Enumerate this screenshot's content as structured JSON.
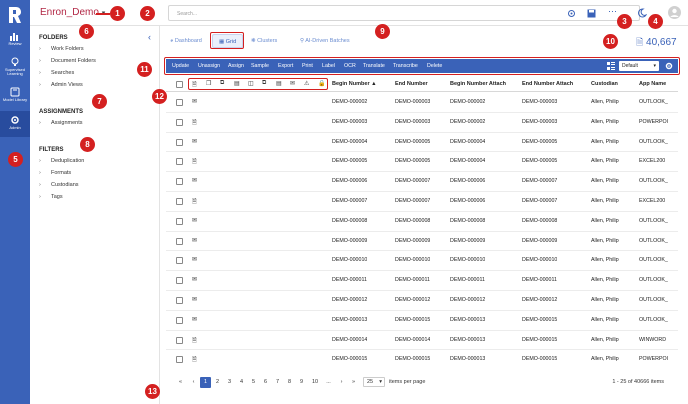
{
  "app": {
    "name": "Enron_Demo",
    "brand_color": "#b22745",
    "accent": "#3a62b8"
  },
  "search": {
    "placeholder": "Search..."
  },
  "rail": [
    {
      "label": "Review"
    },
    {
      "label": "Supervised Learning"
    },
    {
      "label": "Model Library"
    },
    {
      "label": "Admin"
    }
  ],
  "sidebar": {
    "folders_title": "FOLDERS",
    "folders": [
      "Work Folders",
      "Document Folders",
      "Searches",
      "Admin Views"
    ],
    "assignments_title": "ASSIGNMENTS",
    "assignments": [
      "Assignments"
    ],
    "filters_title": "FILTERS",
    "filters": [
      "Deduplication",
      "Formats",
      "Custodians",
      "Tags"
    ]
  },
  "tabs": [
    {
      "label": "Dashboard",
      "icon": "dashboard-icon"
    },
    {
      "label": "Grid",
      "icon": "grid-icon",
      "selected": true
    },
    {
      "label": "Clusters",
      "icon": "clusters-icon"
    },
    {
      "label": "AI-Driven Batches",
      "icon": "location-icon"
    }
  ],
  "doc_count": "40,667",
  "toolbar": {
    "actions": [
      "Update",
      "Unassign",
      "Assign",
      "Sample",
      "Export",
      "Print",
      "Label",
      "OCR",
      "Translate",
      "Transcribe",
      "Delete"
    ],
    "view_name": "Default"
  },
  "grid": {
    "columns": [
      "Begin Number",
      "End Number",
      "Begin Number Attach",
      "End Number Attach",
      "Custodian",
      "App Name"
    ],
    "sort_indicator": "▲",
    "rows": [
      {
        "begin": "DEMO-000002",
        "end": "DEMO-000003",
        "battach": "DEMO-000002",
        "eattach": "DEMO-000003",
        "custodian": "Allen, Philip",
        "app": "OUTLOOK_",
        "type": "mail"
      },
      {
        "begin": "DEMO-000003",
        "end": "DEMO-000003",
        "battach": "DEMO-000002",
        "eattach": "DEMO-000003",
        "custodian": "Allen, Philip",
        "app": "POWERPOI",
        "type": "doc"
      },
      {
        "begin": "DEMO-000004",
        "end": "DEMO-000005",
        "battach": "DEMO-000004",
        "eattach": "DEMO-000005",
        "custodian": "Allen, Philip",
        "app": "OUTLOOK_",
        "type": "mail"
      },
      {
        "begin": "DEMO-000005",
        "end": "DEMO-000005",
        "battach": "DEMO-000004",
        "eattach": "DEMO-000005",
        "custodian": "Allen, Philip",
        "app": "EXCEL200",
        "type": "sheet"
      },
      {
        "begin": "DEMO-000006",
        "end": "DEMO-000007",
        "battach": "DEMO-000006",
        "eattach": "DEMO-000007",
        "custodian": "Allen, Philip",
        "app": "OUTLOOK_",
        "type": "mail"
      },
      {
        "begin": "DEMO-000007",
        "end": "DEMO-000007",
        "battach": "DEMO-000006",
        "eattach": "DEMO-000007",
        "custodian": "Allen, Philip",
        "app": "EXCEL200",
        "type": "sheet"
      },
      {
        "begin": "DEMO-000008",
        "end": "DEMO-000008",
        "battach": "DEMO-000008",
        "eattach": "DEMO-000008",
        "custodian": "Allen, Philip",
        "app": "OUTLOOK_",
        "type": "mail"
      },
      {
        "begin": "DEMO-000009",
        "end": "DEMO-000009",
        "battach": "DEMO-000009",
        "eattach": "DEMO-000009",
        "custodian": "Allen, Philip",
        "app": "OUTLOOK_",
        "type": "mail"
      },
      {
        "begin": "DEMO-000010",
        "end": "DEMO-000010",
        "battach": "DEMO-000010",
        "eattach": "DEMO-000010",
        "custodian": "Allen, Philip",
        "app": "OUTLOOK_",
        "type": "mail"
      },
      {
        "begin": "DEMO-000011",
        "end": "DEMO-000011",
        "battach": "DEMO-000011",
        "eattach": "DEMO-000011",
        "custodian": "Allen, Philip",
        "app": "OUTLOOK_",
        "type": "mail"
      },
      {
        "begin": "DEMO-000012",
        "end": "DEMO-000012",
        "battach": "DEMO-000012",
        "eattach": "DEMO-000012",
        "custodian": "Allen, Philip",
        "app": "OUTLOOK_",
        "type": "mail"
      },
      {
        "begin": "DEMO-000013",
        "end": "DEMO-000015",
        "battach": "DEMO-000013",
        "eattach": "DEMO-000015",
        "custodian": "Allen, Philip",
        "app": "OUTLOOK_",
        "type": "mail"
      },
      {
        "begin": "DEMO-000014",
        "end": "DEMO-000014",
        "battach": "DEMO-000013",
        "eattach": "DEMO-000015",
        "custodian": "Allen, Philip",
        "app": "WINWORD",
        "type": "doc"
      },
      {
        "begin": "DEMO-000015",
        "end": "DEMO-000015",
        "battach": "DEMO-000013",
        "eattach": "DEMO-000015",
        "custodian": "Allen, Philip",
        "app": "POWERPOI",
        "type": "doc"
      }
    ]
  },
  "pager": {
    "first": "«",
    "prev": "‹",
    "pages": [
      "1",
      "2",
      "3",
      "4",
      "5",
      "6",
      "7",
      "8",
      "9",
      "10"
    ],
    "ellipsis": "...",
    "next": "›",
    "last": "»",
    "page_size": "25",
    "per_page_label": "items per page",
    "summary": "1 - 25 of 40666 items"
  },
  "callouts": [
    "1",
    "2",
    "3",
    "4",
    "5",
    "6",
    "7",
    "8",
    "9",
    "10",
    "11",
    "12",
    "13"
  ]
}
